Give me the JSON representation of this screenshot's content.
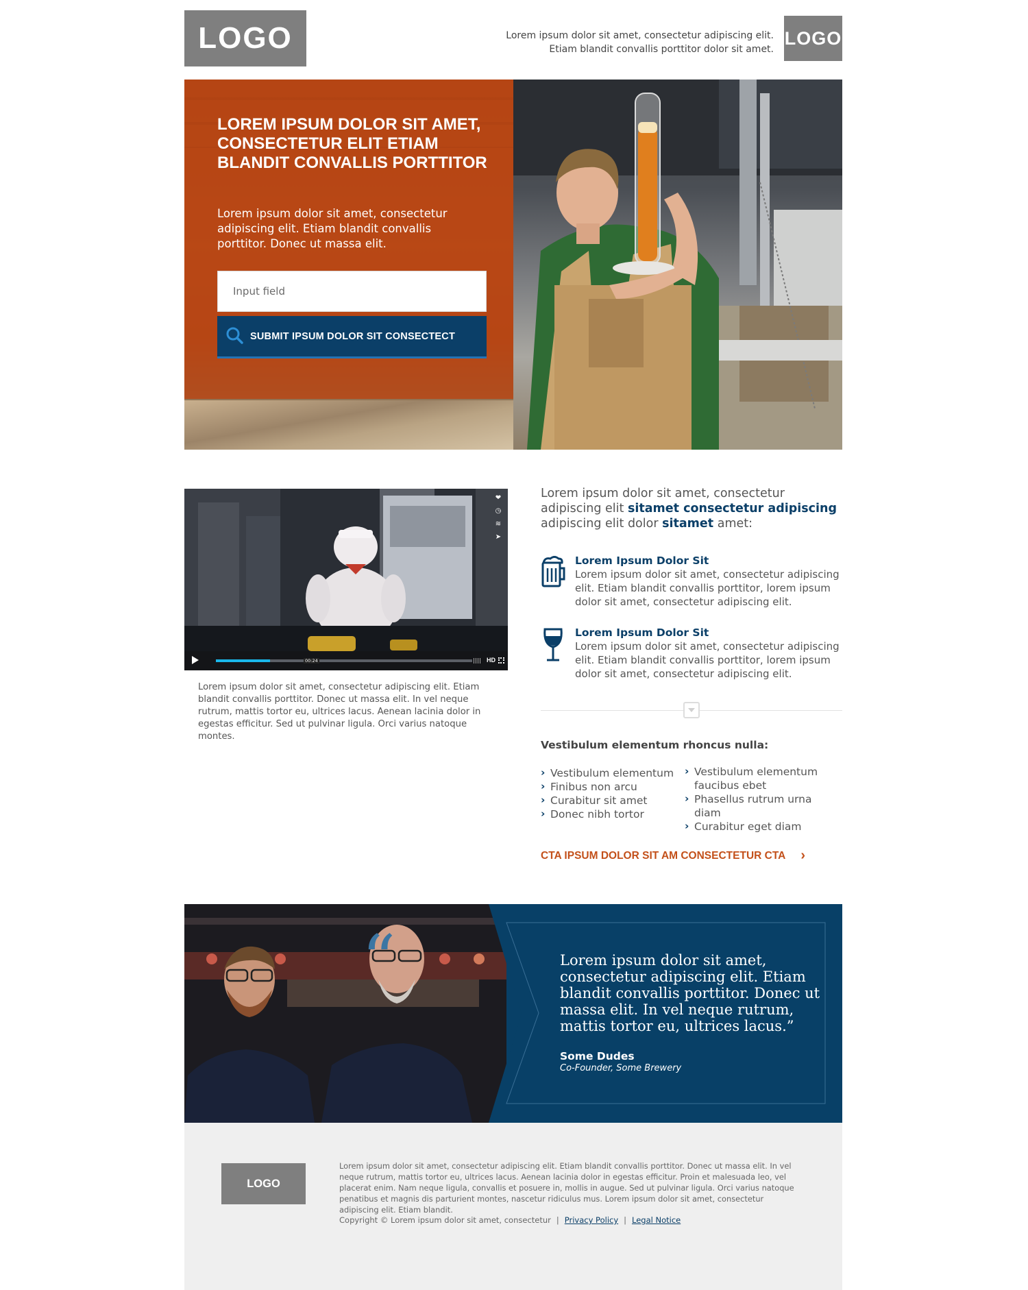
{
  "header": {
    "logo": "LOGO",
    "tagline": "Lorem ipsum dolor sit amet, consectetur adipiscing elit. Etiam blandit convallis porttitor dolor sit amet.",
    "logo_secondary": "LOGO"
  },
  "hero": {
    "title": "LOREM IPSUM DOLOR SIT AMET, CONSECTETUR ELIT ETIAM BLANDIT CONVALLIS PORTTITOR",
    "text": "Lorem ipsum dolor sit amet, consectetur adipiscing elit. Etiam blandit convallis porttitor. Donec ut massa elit.",
    "input_placeholder": "Input field",
    "submit_label": "SUBMIT IPSUM DOLOR SIT CONSECTECT",
    "submit_icon": "search-icon"
  },
  "video": {
    "timestamp": "00:24",
    "progress": 0.21,
    "quality": "HD",
    "side_icons": [
      "heart-icon",
      "clock-icon",
      "layers-icon",
      "send-icon"
    ],
    "caption": "Lorem ipsum dolor sit amet, consectetur adipiscing elit. Etiam blandit convallis porttitor. Donec ut massa elit. In vel neque rutrum, mattis tortor eu, ultrices lacus. Aenean lacinia dolor in egestas efficitur. Sed ut pulvinar ligula. Orci varius natoque montes."
  },
  "intro": {
    "part1": "Lorem ipsum dolor sit amet, consectetur adipiscing elit ",
    "bold1": "sitamet consectetur adipiscing",
    "part2": " adipiscing elit dolor ",
    "bold2": "sitamet",
    "part3": " amet:"
  },
  "features": [
    {
      "icon": "beer-mug-icon",
      "title": "Lorem Ipsum Dolor Sit",
      "text": "Lorem ipsum dolor sit amet, consectetur adipiscing elit. Etiam blandit convallis porttitor, lorem ipsum dolor sit amet, consectetur adipiscing elit."
    },
    {
      "icon": "wine-glass-icon",
      "title": "Lorem Ipsum Dolor Sit",
      "text": "Lorem ipsum dolor sit amet, consectetur adipiscing elit. Etiam blandit convallis porttitor, lorem ipsum dolor sit amet, consectetur adipiscing elit."
    }
  ],
  "list": {
    "title": "Vestibulum elementum rhoncus nulla:",
    "col1": [
      "Vestibulum elementum",
      "Finibus non arcu",
      "Curabitur sit amet",
      "Donec nibh tortor"
    ],
    "col2": [
      "Vestibulum elementum faucibus ebet",
      "Phasellus rutrum urna diam",
      "Curabitur eget diam"
    ]
  },
  "cta": {
    "label": "CTA IPSUM DOLOR SIT AM CONSECTETUR CTA",
    "icon": "chevron-right-icon"
  },
  "testimonial": {
    "quote": "Lorem ipsum dolor sit amet, consectetur adipiscing elit. Etiam blandit convallis porttitor. Donec ut massa elit. In vel neque rutrum, mattis tortor eu, ultrices lacus.”",
    "name": "Some Dudes",
    "role": "Co-Founder, Some Brewery"
  },
  "footer": {
    "logo": "LOGO",
    "text": "Lorem ipsum dolor sit amet, consectetur adipiscing elit. Etiam blandit convallis porttitor. Donec ut massa elit. In vel neque rutrum, mattis tortor eu, ultrices lacus. Aenean lacinia dolor in egestas efficitur. Proin et malesuada leo, vel placerat enim. Nam neque ligula, convallis et posuere in, mollis in augue. Sed ut pulvinar ligula. Orci varius natoque penatibus et magnis dis parturient montes, nascetur ridiculus mus. Lorem ipsum dolor sit amet, consectetur adipiscing elit. Etiam blandit.",
    "copyright": "Copyright © Lorem ipsum dolor sit amet, consectetur",
    "privacy": "Privacy Policy",
    "legal": "Legal Notice"
  }
}
